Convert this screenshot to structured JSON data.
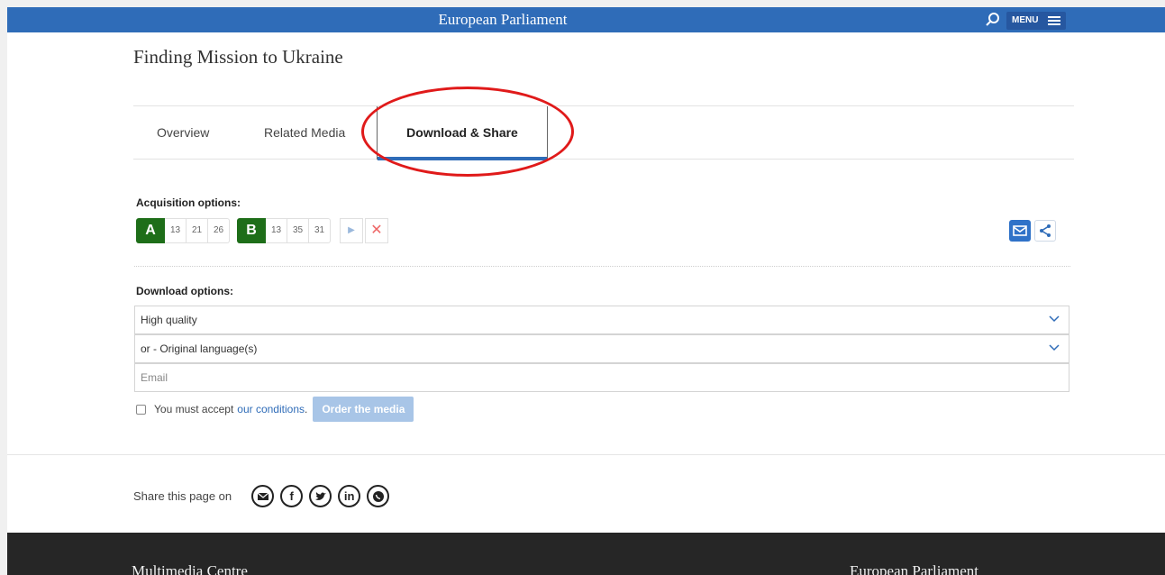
{
  "header": {
    "brand": "European Parliament",
    "menu_label": "MENU"
  },
  "page": {
    "title": "Finding Mission to Ukraine"
  },
  "tabs": [
    {
      "label": "Overview"
    },
    {
      "label": "Related Media"
    },
    {
      "label": "Download & Share",
      "active": true
    }
  ],
  "acquisition": {
    "label": "Acquisition options:",
    "group_a": {
      "letter": "A",
      "numbers": [
        "13",
        "21",
        "26"
      ]
    },
    "group_b": {
      "letter": "B",
      "numbers": [
        "13",
        "35",
        "31"
      ]
    },
    "play_symbol": "▶",
    "clear_symbol": "✕"
  },
  "download": {
    "label": "Download options:",
    "quality_value": "High quality",
    "language_value": "or - Original language(s)",
    "email_placeholder": "Email"
  },
  "accept": {
    "prefix": "You must accept",
    "link": "our conditions",
    "suffix": ".",
    "order_button": "Order the media"
  },
  "share": {
    "label": "Share this page on",
    "icons": [
      "email-icon",
      "facebook-icon",
      "twitter-icon",
      "linkedin-icon",
      "whatsapp-icon"
    ],
    "facebook_glyph": "f",
    "linkedin_glyph": "in"
  },
  "footer": {
    "left": "Multimedia Centre",
    "right": "European Parliament"
  },
  "colors": {
    "brand_blue": "#2f6cb8",
    "group_green": "#1e6e19",
    "highlight_red": "#e01a1a",
    "footer_bg": "#262626"
  }
}
